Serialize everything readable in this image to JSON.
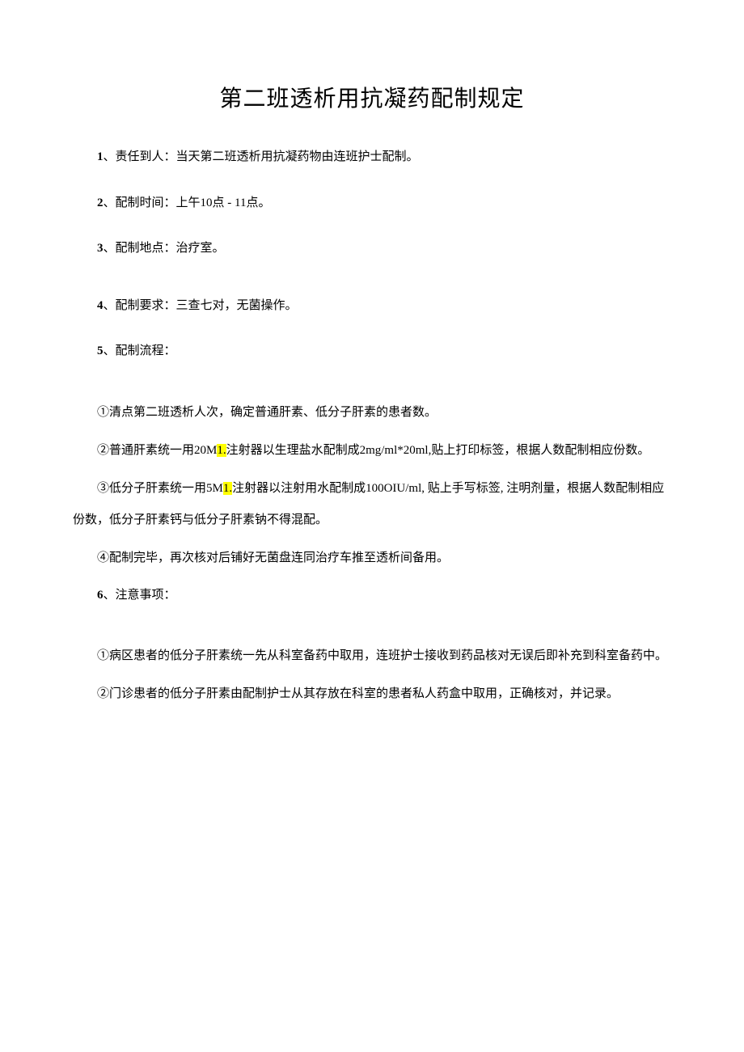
{
  "title": "第二班透析用抗凝药配制规定",
  "items": {
    "n1": "1",
    "l1": "、责任到人：当天第二班透析用抗凝药物由连班护士配制。",
    "n2": "2",
    "l2": "、配制时间：上午10点 - 11点。",
    "n3": "3",
    "l3": "、配制地点：治疗室。",
    "n4": "4",
    "l4": "、配制要求：三查七对，无菌操作。",
    "n5": "5",
    "l5": "、配制流程：",
    "s1": "①清点第二班透析人次，确定普通肝素、低分子肝素的患者数。",
    "s2a": "②普通肝素统一用20M",
    "s2h": "1.",
    "s2b": "注射器以生理盐水配制成2mg/ml*20ml,贴上打印标签，根据人数配制相应份数。",
    "s3a": "③低分子肝素统一用5M",
    "s3h": "1.",
    "s3b": "注射器以注射用水配制成100OIU/ml, 贴上手写标签, 注明剂量，根据人数配制相应份数，低分子肝素钙与低分子肝素钠不得混配。",
    "s4": "④配制完毕，再次核对后铺好无菌盘连同治疗车推至透析间备用。",
    "n6": "6",
    "l6": "、注意事项：",
    "t1": "①病区患者的低分子肝素统一先从科室备药中取用，连班护士接收到药品核对无误后即补充到科室备药中。",
    "t2": "②门诊患者的低分子肝素由配制护士从其存放在科室的患者私人药盒中取用，正确核对，并记录。"
  }
}
